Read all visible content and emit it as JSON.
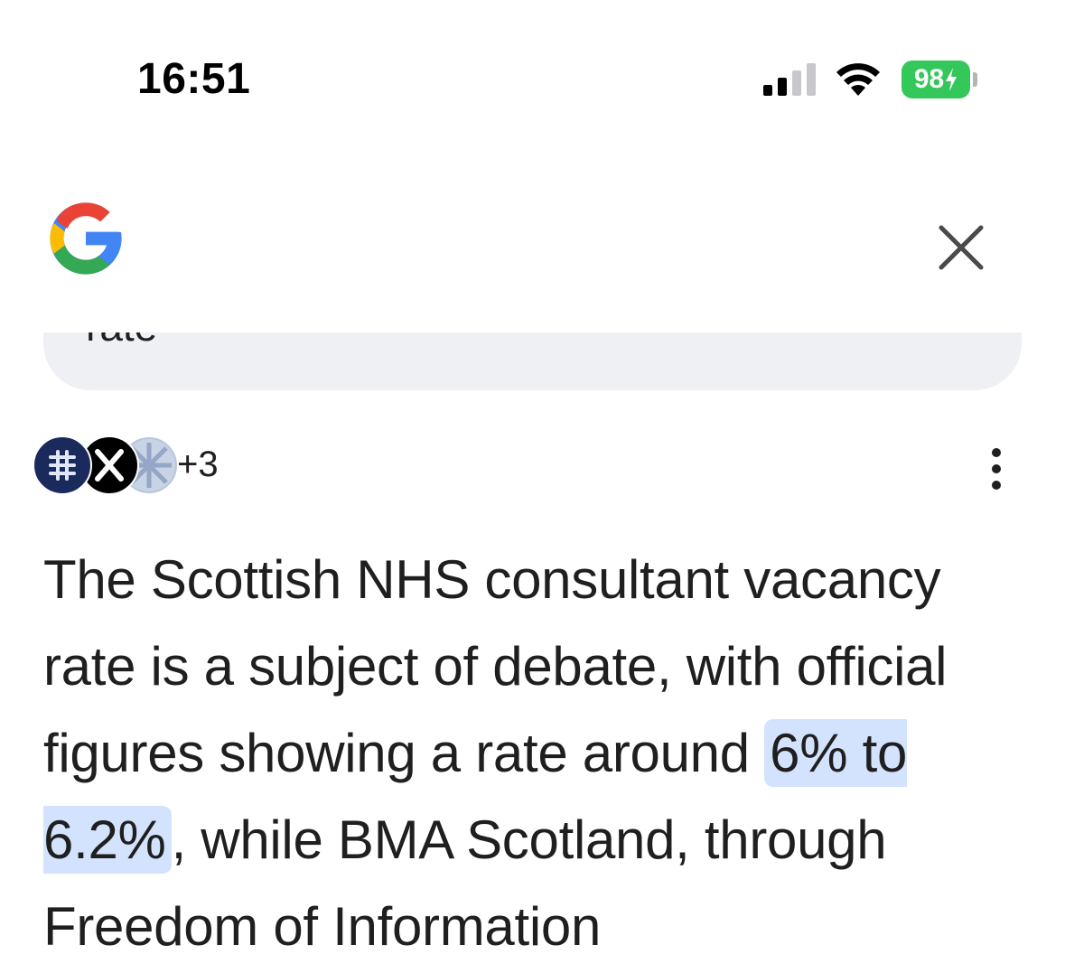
{
  "status_bar": {
    "time": "16:51",
    "battery_level": "98",
    "battery_color": "#34c759",
    "signal_icon": "cellular-signal-icon",
    "wifi_icon": "wifi-icon",
    "charging_icon": "bolt-icon"
  },
  "header": {
    "logo_icon": "google-g-icon",
    "close_icon": "close-icon"
  },
  "search": {
    "partial_query": "rate"
  },
  "sources": {
    "icons": [
      "source-logo-icon",
      "x-logo-icon",
      "blurred-source-icon"
    ],
    "more_count": "+3",
    "menu_icon": "more-vert-icon"
  },
  "answer": {
    "part1": "The Scottish NHS consultant vacancy rate is a subject of debate, with official figures showing a rate around ",
    "highlight": "6% to 6.2%",
    "part2": ", while BMA Scotland, through Freedom of Information",
    "highlight_color": "#d3e3fd"
  }
}
